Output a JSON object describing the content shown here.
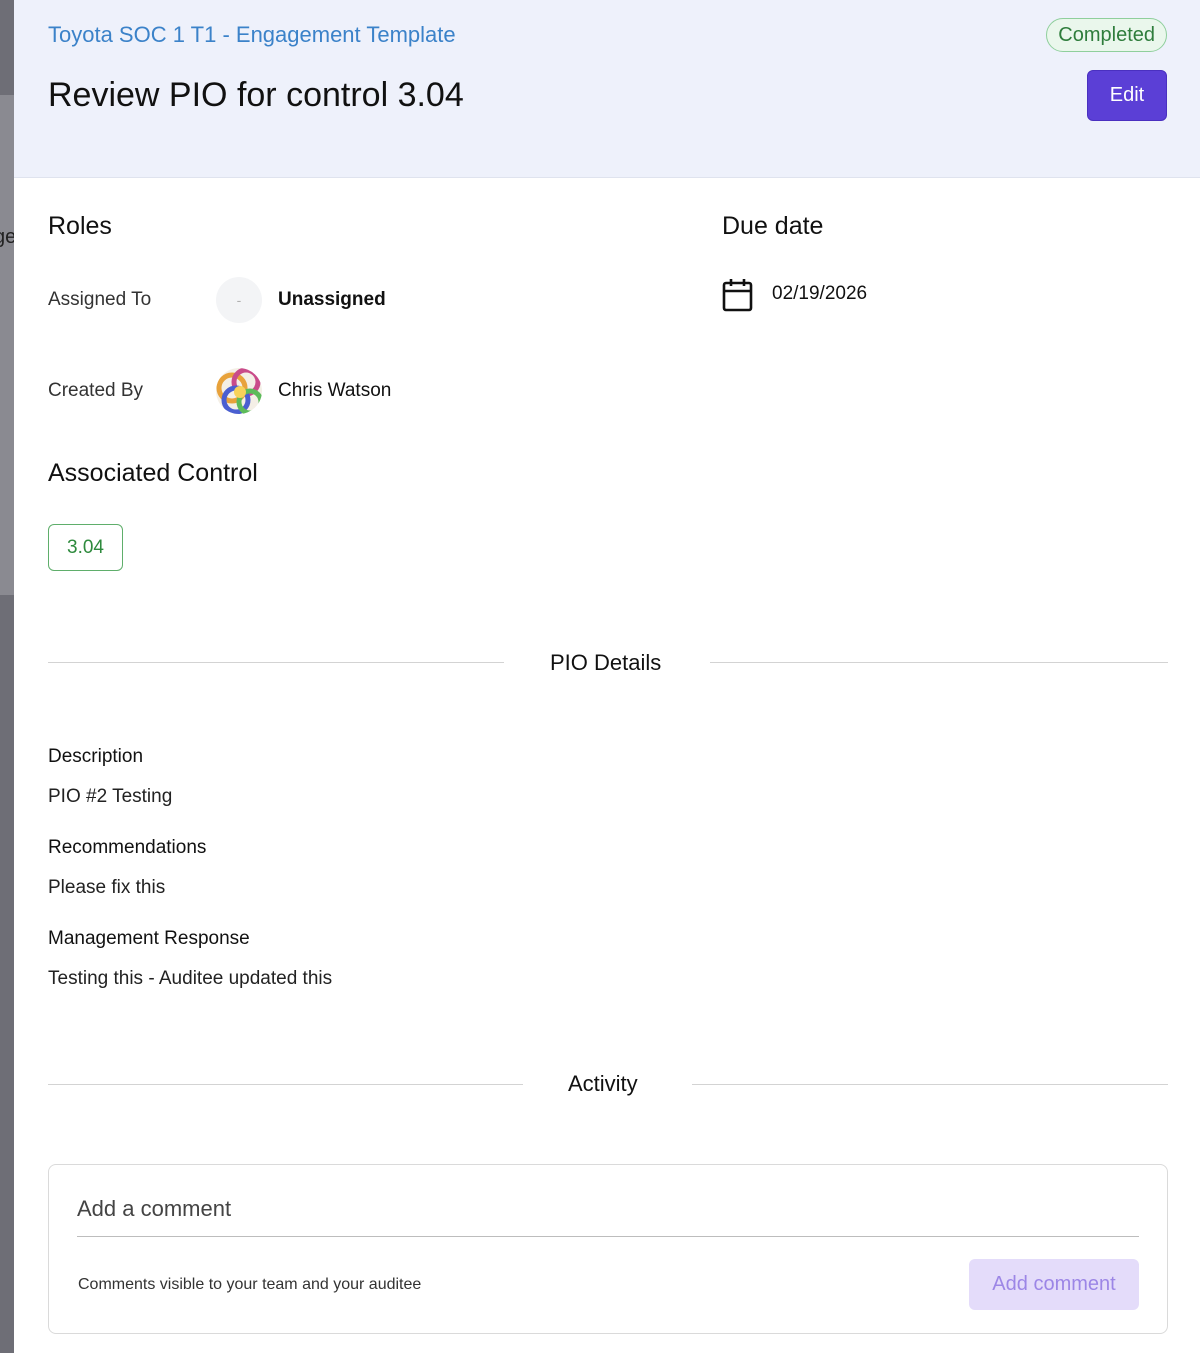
{
  "background": {
    "partial_text": "ge"
  },
  "header": {
    "breadcrumb": "Toyota SOC 1 T1 - Engagement Template",
    "title": "Review PIO for control 3.04",
    "status": "Completed",
    "edit_label": "Edit"
  },
  "roles": {
    "heading": "Roles",
    "assigned_to_label": "Assigned To",
    "assigned_avatar_placeholder": "-",
    "assigned_to_value": "Unassigned",
    "created_by_label": "Created By",
    "created_by_value": "Chris Watson"
  },
  "due": {
    "heading": "Due date",
    "icon": "calendar-icon",
    "value": "02/19/2026"
  },
  "associated_control": {
    "heading": "Associated Control",
    "chip": "3.04"
  },
  "pio_details": {
    "heading": "PIO Details",
    "description_label": "Description",
    "description_value": "PIO #2 Testing",
    "recommendations_label": "Recommendations",
    "recommendations_value": "Please fix this",
    "management_response_label": "Management Response",
    "management_response_value": "Testing this - Auditee updated this"
  },
  "activity": {
    "heading": "Activity",
    "comment_placeholder": "Add a comment",
    "hint": "Comments visible to your team and your auditee",
    "add_comment_label": "Add comment"
  },
  "colors": {
    "accent": "#5b3fd6",
    "link": "#3b82c9",
    "success": "#2f7d3c",
    "header_bg": "#eef1fb"
  }
}
